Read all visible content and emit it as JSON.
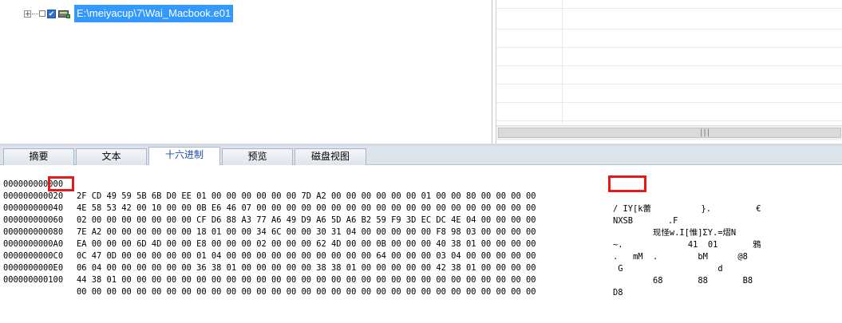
{
  "tree": {
    "expander_glyph": "+",
    "checkbox_glyph": "✔",
    "item_label": "E:\\meiyacup\\7\\Wai_Macbook.e01",
    "icon": "drive-icon"
  },
  "right_pane": {
    "scroll_grip": "|||"
  },
  "tabs": [
    "摘要",
    "文本",
    "十六进制",
    "预览",
    "磁盘视图"
  ],
  "active_tab": "十六进制",
  "hex_view": {
    "rows": [
      {
        "offset": "000000000000",
        "bytes": "2F CD 49 59 5B 6B D0 EE 01 00 00 00 00 00 00 7D A2 00 00 00 00 00 00 01 00 00 80 00 00 00 00",
        "ascii": "/ IY[k蕾          }.         €"
      },
      {
        "offset": "000000000020",
        "bytes": "4E 58 53 42 00 10 00 00 0B E6 46 07 00 00 00 00 00 00 00 00 00 00 00 00 00 00 00 00 00 00 00",
        "ascii": "NXSB       .F"
      },
      {
        "offset": "000000000040",
        "bytes": "02 00 00 00 00 00 00 00 CF D6 88 A3 77 A6 49 D9 A6 5D A6 B2 59 F9 3D EC DC 4E 04 00 00 00 00",
        "ascii": "        现怪w.I[惟]ΣY.=熠N"
      },
      {
        "offset": "000000000060",
        "bytes": "7E A2 00 00 00 00 00 00 18 01 00 00 34 6C 00 00 30 31 04 00 00 00 00 00 F8 98 03 00 00 00 00",
        "ascii": "~.             41  01       鴉"
      },
      {
        "offset": "000000000080",
        "bytes": "EA 00 00 00 6D 4D 00 00 E8 00 00 00 02 00 00 00 62 4D 00 00 0B 00 00 00 40 38 01 00 00 00 00",
        "ascii": ".   mM  .        bM      @8"
      },
      {
        "offset": "0000000000A0",
        "bytes": "0C 47 0D 00 00 00 00 00 01 04 00 00 00 00 00 00 00 00 00 00 64 00 00 00 03 04 00 00 00 00 00",
        "ascii": " G                   d"
      },
      {
        "offset": "0000000000C0",
        "bytes": "06 04 00 00 00 00 00 00 36 38 01 00 00 00 00 00 38 38 01 00 00 00 00 00 42 38 01 00 00 00 00",
        "ascii": "        68       88       B8"
      },
      {
        "offset": "0000000000E0",
        "bytes": "44 38 01 00 00 00 00 00 00 00 00 00 00 00 00 00 00 00 00 00 00 00 00 00 00 00 00 00 00 00 00",
        "ascii": "D8"
      },
      {
        "offset": "000000000100",
        "bytes": "00 00 00 00 00 00 00 00 00 00 00 00 00 00 00 00 00 00 00 00 00 00 00 00 00 00 00 00 00 00 00",
        "ascii": ""
      }
    ]
  },
  "annotation_color": "#e31a1c",
  "selection_color": "#3399ff"
}
